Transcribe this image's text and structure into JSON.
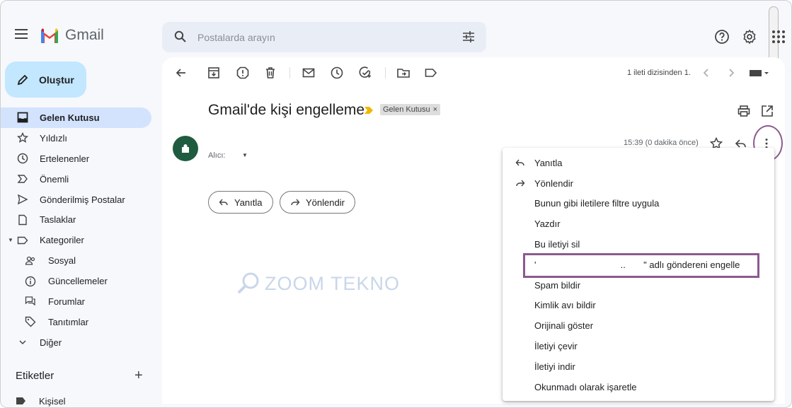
{
  "app": {
    "name": "Gmail"
  },
  "search": {
    "placeholder": "Postalarda arayın"
  },
  "compose": {
    "label": "Oluştur"
  },
  "sidebar": {
    "items": [
      {
        "label": "Gelen Kutusu",
        "icon": "inbox-icon",
        "active": true
      },
      {
        "label": "Yıldızlı",
        "icon": "star-icon"
      },
      {
        "label": "Ertelenenler",
        "icon": "clock-icon"
      },
      {
        "label": "Önemli",
        "icon": "important-icon"
      },
      {
        "label": "Gönderilmiş Postalar",
        "icon": "send-icon"
      },
      {
        "label": "Taslaklar",
        "icon": "draft-icon"
      },
      {
        "label": "Kategoriler",
        "icon": "label-icon"
      },
      {
        "label": "Sosyal",
        "icon": "people-icon"
      },
      {
        "label": "Güncellemeler",
        "icon": "info-icon"
      },
      {
        "label": "Forumlar",
        "icon": "forum-icon"
      },
      {
        "label": "Tanıtımlar",
        "icon": "tag-icon"
      },
      {
        "label": "Diğer",
        "icon": "chevron-down-icon"
      }
    ],
    "labels_header": "Etiketler",
    "labels": [
      {
        "label": "Kişisel"
      }
    ]
  },
  "toolbar": {
    "pager_text": "1 ileti dizisinden 1."
  },
  "message": {
    "subject": "Gmail'de kişi engelleme",
    "badge": "Gelen Kutusu",
    "badge_close": "×",
    "recipient_label": "Alıcı:",
    "time": "15:39 (0 dakika önce)",
    "reply_button": "Yanıtla",
    "forward_button": "Yönlendir"
  },
  "watermark": "ZOOM TEKNO",
  "menu": {
    "items": [
      {
        "label": "Yanıtla",
        "icon": "reply-icon"
      },
      {
        "label": "Yönlendir",
        "icon": "forward-icon"
      },
      {
        "label": "Bunun gibi iletilere filtre uygula"
      },
      {
        "label": "Yazdır"
      },
      {
        "label": "Bu iletiyi sil"
      },
      {
        "label": "'                                 ..       \" adlı göndereni engelle"
      },
      {
        "label": "Spam bildir"
      },
      {
        "label": "Kimlik avı bildir"
      },
      {
        "label": "Orijinali göster"
      },
      {
        "label": "İletiyi çevir"
      },
      {
        "label": "İletiyi indir"
      },
      {
        "label": "Okunmadı olarak işaretle"
      }
    ]
  },
  "colors": {
    "accent_highlight": "#8b5a8f",
    "compose_bg": "#c2e7ff",
    "active_nav_bg": "#d3e3fd"
  }
}
